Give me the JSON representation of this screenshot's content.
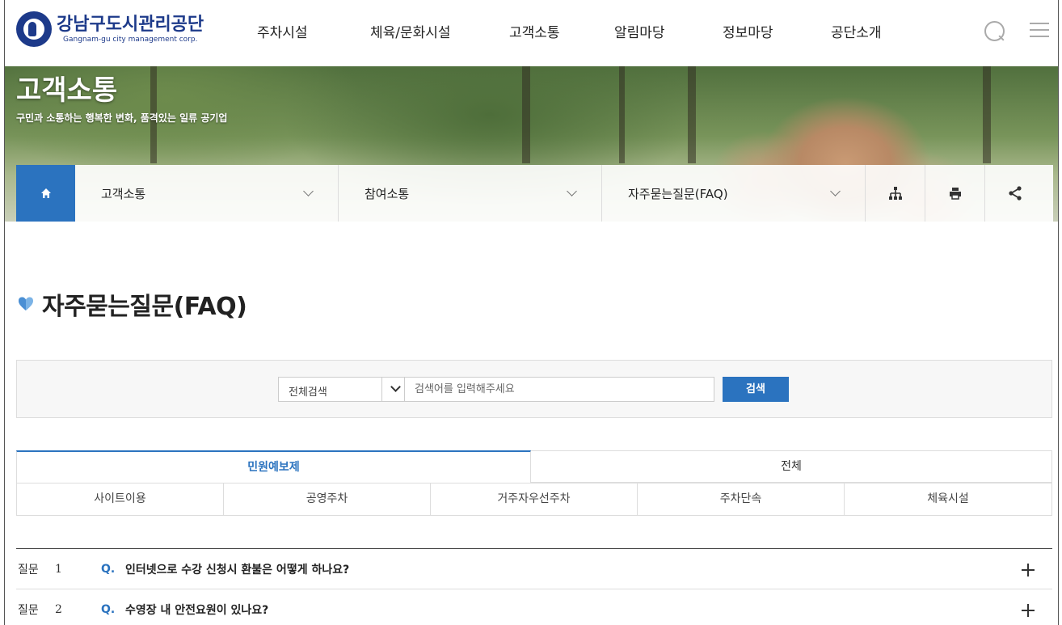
{
  "header": {
    "logo_ko": "강남구도시관리공단",
    "logo_en": "Gangnam-gu city management corp.",
    "nav": [
      "주차시설",
      "체육/문화시설",
      "고객소통",
      "알림마당",
      "정보마당",
      "공단소개"
    ]
  },
  "banner": {
    "title": "고객소통",
    "subtitle": "구민과 소통하는 행복한 변화, 품격있는 일류 공기업"
  },
  "location": {
    "items": [
      "고객소통",
      "참여소통",
      "자주묻는질문(FAQ)"
    ]
  },
  "page": {
    "title": "자주묻는질문(FAQ)"
  },
  "search": {
    "select_value": "전체검색",
    "placeholder": "검색어를 입력해주세요",
    "button": "검색"
  },
  "tabs": {
    "primary": [
      "민원예보제",
      "전체"
    ],
    "secondary": [
      "사이트이용",
      "공영주차",
      "거주자우선주차",
      "주차단속",
      "체육시설"
    ]
  },
  "faq": {
    "label": "질문",
    "q_mark": "Q.",
    "items": [
      {
        "num": "1",
        "text": "인터넷으로 수강 신청시 환불은 어떻게 하나요?"
      },
      {
        "num": "2",
        "text": "수영장 내 안전요원이 있나요?"
      }
    ]
  },
  "colors": {
    "brand": "#1d3a8a",
    "accent": "#2b73bf"
  }
}
